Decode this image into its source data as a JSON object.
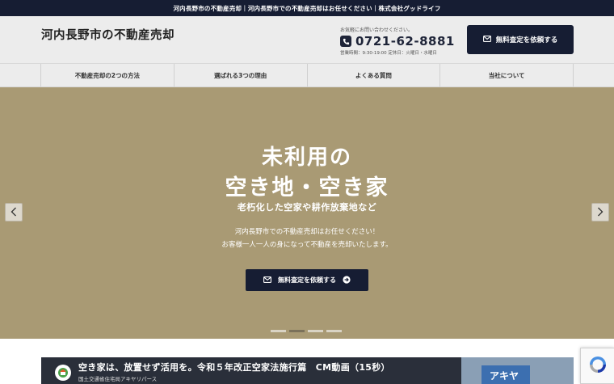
{
  "topbar": {
    "text": "河内長野市の不動産売却｜河内長野市での不動産売却はお任せください｜株式会社グッドライフ"
  },
  "header": {
    "site_title": "河内長野市の不動産売却",
    "contact_note": "お気軽にお問い合わせください。",
    "phone": "0721-62-8881",
    "hours": "営業時間：9:30-19:00 定休日：火曜日・水曜日",
    "cta_label": "無料査定を依頼する"
  },
  "nav": {
    "items": [
      {
        "label": "不動産売却の2つの方法"
      },
      {
        "label": "選ばれる3つの理由"
      },
      {
        "label": "よくある質問"
      },
      {
        "label": "当社について"
      }
    ]
  },
  "hero": {
    "line1": "未利用の",
    "line2": "空き地・空き家",
    "sub": "老朽化した空家や耕作放棄地など",
    "desc1": "河内長野市での不動産売却はお任せください！",
    "desc2": "お客様一人一人の身になって不動産を売却いたします。",
    "cta_label": "無料査定を依頼する",
    "slide_count": 4,
    "active_slide": 2
  },
  "video": {
    "title": "空き家は、放置せず活用を。令和５年改正空家法施行篇　CM動画（15秒）",
    "channel": "国土交通省住宅局アキヤリパース",
    "overlay_text": "アキヤ"
  },
  "colors": {
    "navy": "#161d33",
    "hero_bg": "#a99a74",
    "header_bg": "#ececec"
  }
}
